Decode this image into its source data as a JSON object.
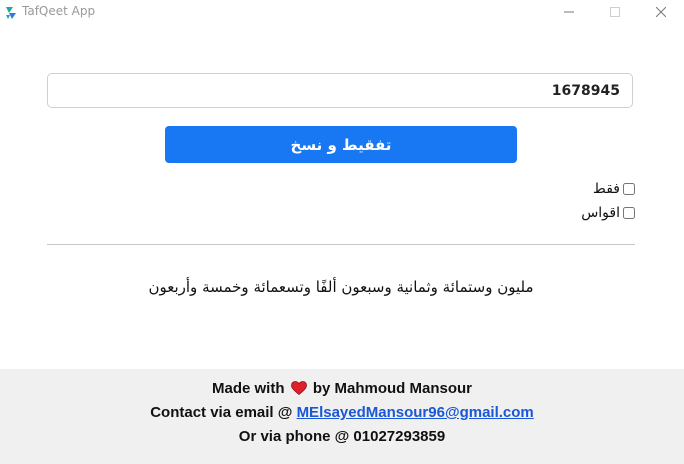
{
  "window": {
    "title": "TafQeet App",
    "icons": [
      "app-icon",
      "minimize-icon",
      "maximize-icon",
      "close-icon"
    ]
  },
  "input": {
    "value": "1678945",
    "placeholder": ""
  },
  "convert_button": {
    "label": "تفقيط و نسخ"
  },
  "options": [
    {
      "label": "فقط",
      "checked": false
    },
    {
      "label": "اقواس",
      "checked": false
    }
  ],
  "result": {
    "text": "مليون وستمائة وثمانية وسبعون ألفًا وتسعمائة وخمسة وأربعون"
  },
  "footer": {
    "made_with_prefix": "Made with",
    "made_with_suffix": "by Mahmoud Mansour",
    "contact_prefix": "Contact via email @",
    "email": "MElsayedMansour96@gmail.com",
    "phone_line": "Or via phone @ 01027293859"
  },
  "colors": {
    "accent": "#1877f2",
    "footer_bg": "#f0f0f0",
    "heart": "#e0202a",
    "link": "#1a57d6"
  }
}
